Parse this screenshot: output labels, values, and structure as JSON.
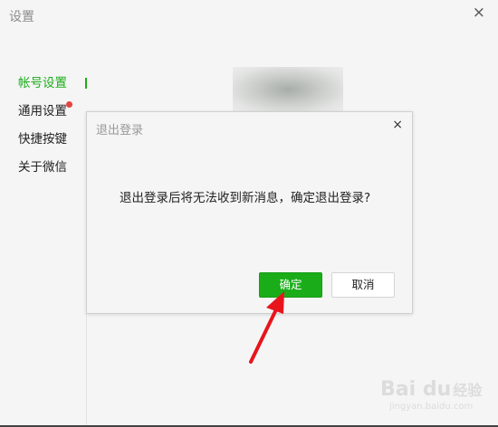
{
  "window": {
    "title": "设置",
    "close_glyph": "×"
  },
  "sidebar": {
    "items": [
      {
        "label": "帐号设置"
      },
      {
        "label": "通用设置"
      },
      {
        "label": "快捷按键"
      },
      {
        "label": "关于微信"
      }
    ]
  },
  "dialog": {
    "title": "退出登录",
    "close_glyph": "×",
    "message": "退出登录后将无法收到新消息，确定退出登录?",
    "ok_label": "确定",
    "cancel_label": "取消"
  },
  "watermark": {
    "logo": "Bai du",
    "cn": "经验",
    "url": "jingyan.baidu.com"
  },
  "colors": {
    "accent": "#1aad19",
    "badge": "#e64340",
    "arrow": "#e8141c"
  },
  "icons": {
    "window_close": "close-icon",
    "dialog_close": "close-icon",
    "annotation": "red-arrow-icon"
  }
}
